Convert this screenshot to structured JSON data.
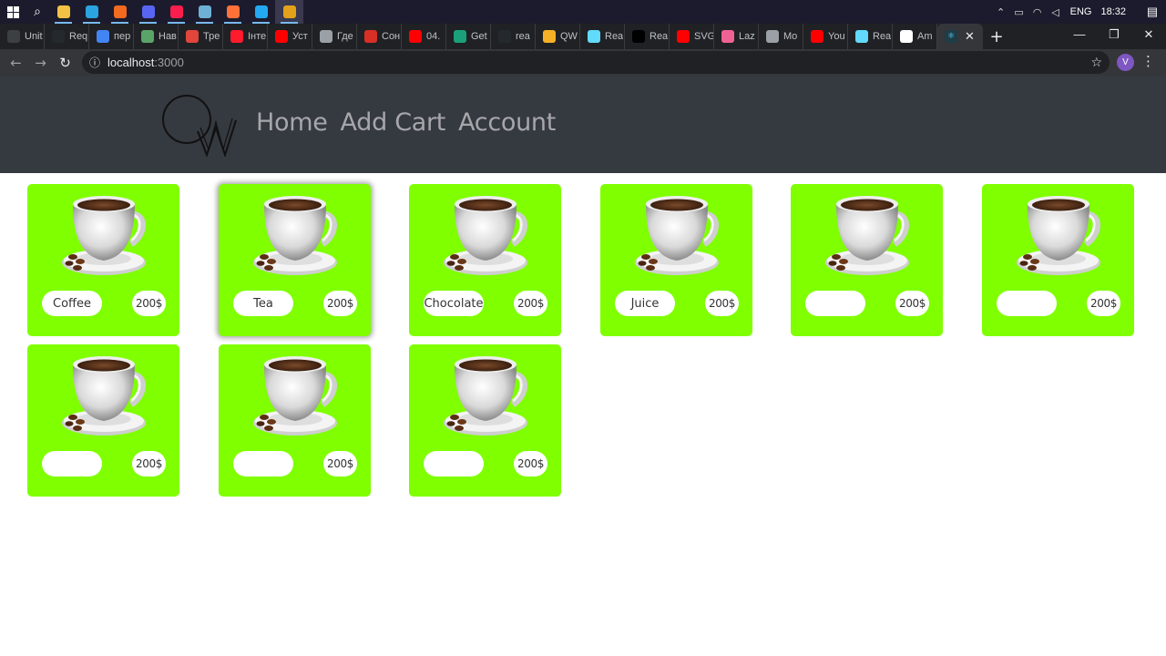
{
  "taskbar": {
    "pinned": [
      {
        "icon": "file-explorer-icon",
        "color": "#f3c244"
      },
      {
        "icon": "telegram-icon",
        "color": "#2aa3e0"
      },
      {
        "icon": "media-player-icon",
        "color": "#f26b21"
      },
      {
        "icon": "discord-icon",
        "color": "#5865f2"
      },
      {
        "icon": "opera-gx-icon",
        "color": "#fa1e4e"
      },
      {
        "icon": "notes-icon",
        "color": "#6fb1d6"
      },
      {
        "icon": "firefox-icon",
        "color": "#ff7139"
      },
      {
        "icon": "vscode-icon",
        "color": "#23a9f2"
      },
      {
        "icon": "chrome-icon",
        "color": "#e3a21a"
      }
    ],
    "language": "ENG",
    "time": "18:32"
  },
  "browser": {
    "tabs": [
      {
        "label": "Unit",
        "icon": "app-icon",
        "color": "#3c4043"
      },
      {
        "label": "Req",
        "icon": "github-icon",
        "color": "#24292e"
      },
      {
        "label": "пер",
        "icon": "google-icon",
        "color": "#4285f4"
      },
      {
        "label": "Нав",
        "icon": "app-icon",
        "color": "#5aa469"
      },
      {
        "label": "Тре",
        "icon": "app-icon",
        "color": "#e2453c"
      },
      {
        "label": "Інте",
        "icon": "opera-icon",
        "color": "#ff1b2d"
      },
      {
        "label": "Уст",
        "icon": "youtube-icon",
        "color": "#ff0000"
      },
      {
        "label": "Где",
        "icon": "app-icon",
        "color": "#9aa0a6"
      },
      {
        "label": "Сон",
        "icon": "app-icon",
        "color": "#d93025"
      },
      {
        "label": "04.",
        "icon": "youtube-icon",
        "color": "#ff0000"
      },
      {
        "label": "Get",
        "icon": "react-icon",
        "color": "#1aa179"
      },
      {
        "label": "rea",
        "icon": "github-icon",
        "color": "#24292e"
      },
      {
        "label": "QW",
        "icon": "app-icon",
        "color": "#f6b026"
      },
      {
        "label": "Rea",
        "icon": "react-icon",
        "color": "#61dafb"
      },
      {
        "label": "Rea",
        "icon": "app-icon",
        "color": "#000000"
      },
      {
        "label": "SVG",
        "icon": "youtube-icon",
        "color": "#ff0000"
      },
      {
        "label": "Laz",
        "icon": "app-icon",
        "color": "#f06292"
      },
      {
        "label": "Mo",
        "icon": "app-icon",
        "color": "#9aa0a6"
      },
      {
        "label": "You",
        "icon": "youtube-icon",
        "color": "#ff0000"
      },
      {
        "label": "Rea",
        "icon": "react-icon",
        "color": "#61dafb"
      },
      {
        "label": "Am",
        "icon": "amazon-icon",
        "color": "#ffffff"
      }
    ],
    "active_tab": {
      "icon": "react-icon",
      "color": "#61dafb",
      "close": "✕"
    },
    "new_tab": "+",
    "url_host": "localhost",
    "url_port": ":3000",
    "profile_initial": "V"
  },
  "site": {
    "nav": [
      "Home",
      "Add Cart",
      "Account"
    ],
    "card_color": "#7fff00",
    "products": [
      {
        "name": "Coffee",
        "price": "200$"
      },
      {
        "name": "Tea",
        "price": "200$"
      },
      {
        "name": "Chocolate",
        "price": "200$"
      },
      {
        "name": "Juice",
        "price": "200$"
      },
      {
        "name": "",
        "price": "200$"
      },
      {
        "name": "",
        "price": "200$"
      },
      {
        "name": "",
        "price": "200$"
      },
      {
        "name": "",
        "price": "200$"
      },
      {
        "name": "",
        "price": "200$"
      }
    ]
  }
}
